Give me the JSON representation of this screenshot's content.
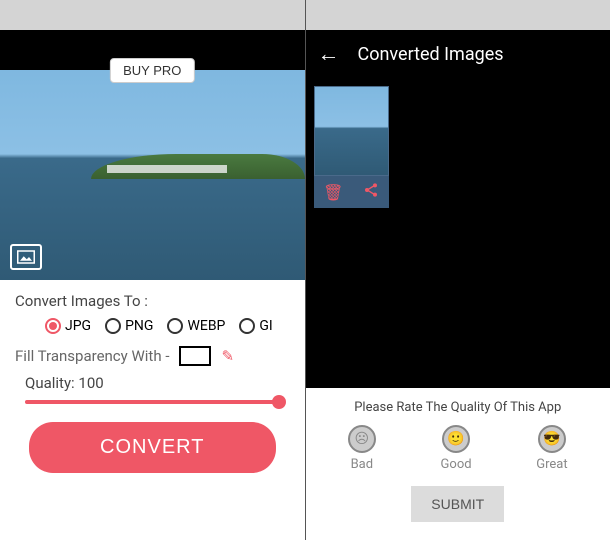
{
  "left": {
    "buy_pro": "BUY PRO",
    "convert_to_label": "Convert Images To :",
    "formats": [
      "JPG",
      "PNG",
      "WEBP",
      "GI"
    ],
    "selected_format": "JPG",
    "fill_label": "Fill Transparency With -",
    "fill_color": "#ffffff",
    "quality_label": "Quality:",
    "quality_value": "100",
    "convert_button": "CONVERT"
  },
  "right": {
    "header_title": "Converted Images",
    "rating_prompt": "Please Rate The Quality Of This App",
    "faces": [
      {
        "label": "Bad"
      },
      {
        "label": "Good"
      },
      {
        "label": "Great"
      }
    ],
    "submit": "SUBMIT"
  }
}
